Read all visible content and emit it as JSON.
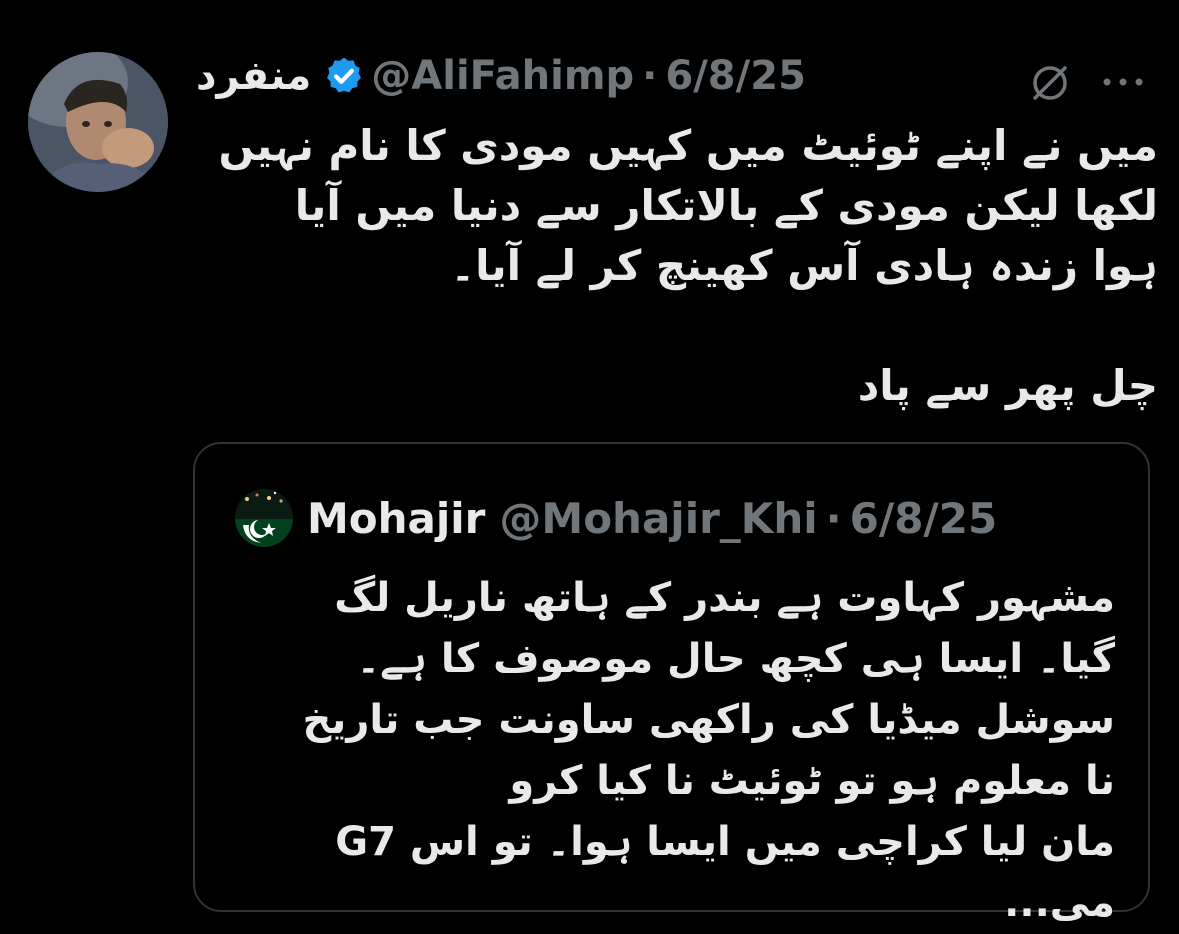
{
  "tweet": {
    "author": {
      "display_name": "منفرد",
      "handle": "@AliFahimp",
      "avatar_icon": "user-avatar-photo",
      "verified_icon": "verified-badge-icon",
      "verified_color": "#1d9bf0"
    },
    "separator": "·",
    "date": "6/8/25",
    "actions": {
      "grok_icon": "grok-icon",
      "more_icon": "more-icon"
    },
    "text": "میں نے اپنے ٹوئیٹ میں کہیں مودی کا نام نہیں\nلکھا لیکن مودی کے بالاتکار سے دنیا میں آیا\nہوا زندہ ہادی آس کھینچ کر لے آیا۔\n\nچل پھر سے پاد"
  },
  "quoted_tweet": {
    "author": {
      "display_name": "Mohajir",
      "handle": "@Mohajir_Khi",
      "avatar_icon": "pakistan-flag-avatar"
    },
    "separator": "·",
    "date": "6/8/25",
    "text": "مشہور کہاوت ہے بندر کے ہاتھ ناریل لگ\nگیا۔ ایسا ہی کچھ حال موصوف کا ہے۔\nسوشل میڈیا کی راکھی ساونت جب تاریخ\nنا معلوم ہو تو ٹوئیٹ نا کیا کرو\nمان لیا کراچی میں ایسا ہوا۔ تو اس G7 می..."
  },
  "colors": {
    "background": "#000000",
    "text": "#e7e9ea",
    "secondary_text": "#71767b",
    "border": "#2f3336"
  }
}
